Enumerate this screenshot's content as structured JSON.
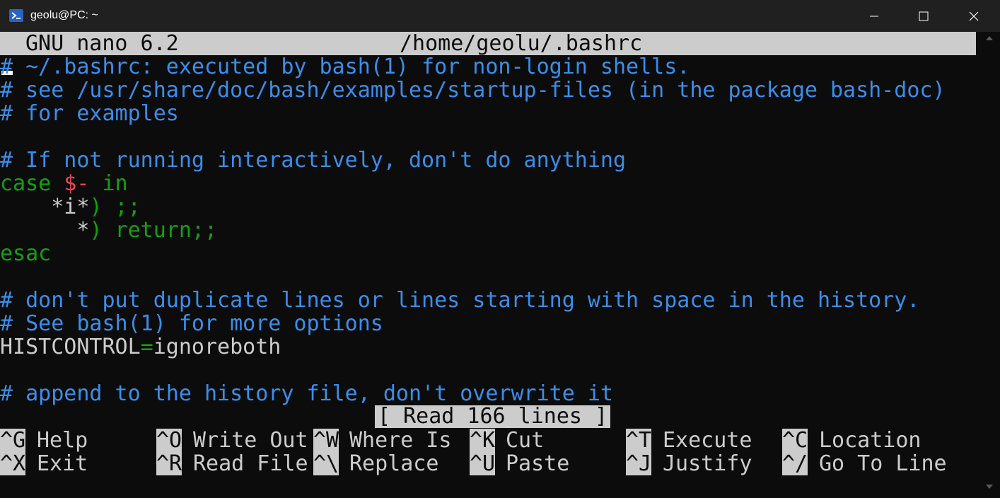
{
  "window": {
    "title": "geolu@PC: ~",
    "icon": "powershell-icon"
  },
  "nano": {
    "version": "GNU nano 6.2",
    "filename": "/home/geolu/.bashrc"
  },
  "lines": [
    "# ~/.bashrc: executed by bash(1) for non-login shells.",
    "# see /usr/share/doc/bash/examples/startup-files (in the package bash-doc)",
    "# for examples",
    "",
    "# If not running interactively, don't do anything",
    "case $- in",
    "    *i*) ;;",
    "      *) return;;",
    "esac",
    "",
    "# don't put duplicate lines or lines starting with space in the history.",
    "# See bash(1) for more options",
    "HISTCONTROL=ignoreboth",
    "",
    "# append to the history file, don't overwrite it"
  ],
  "tokens": {
    "case_kw": "case",
    "dollar_dash": "$-",
    "in_kw": " in",
    "glob_i": "*i*",
    "paren_semis": ") ;;",
    "star": "*",
    "paren_return": ") return;;",
    "esac_kw": "esac",
    "hist_var": "HISTCONTROL",
    "equals": "=",
    "hist_val": "ignoreboth"
  },
  "status_message": "[ Read 166 lines ]",
  "shortcuts": {
    "row1": [
      {
        "key": "^G",
        "label": "Help"
      },
      {
        "key": "^O",
        "label": "Write Out"
      },
      {
        "key": "^W",
        "label": "Where Is"
      },
      {
        "key": "^K",
        "label": "Cut"
      },
      {
        "key": "^T",
        "label": "Execute"
      },
      {
        "key": "^C",
        "label": "Location"
      }
    ],
    "row2": [
      {
        "key": "^X",
        "label": "Exit"
      },
      {
        "key": "^R",
        "label": "Read File"
      },
      {
        "key": "^\\",
        "label": "Replace"
      },
      {
        "key": "^U",
        "label": "Paste"
      },
      {
        "key": "^J",
        "label": "Justify"
      },
      {
        "key": "^/",
        "label": "Go To Line"
      }
    ]
  },
  "colors": {
    "comment": "#3b8eea",
    "keyword": "#13a10e",
    "variable": "#e74856",
    "foreground": "#cccccc",
    "background": "#0c0c0c"
  }
}
